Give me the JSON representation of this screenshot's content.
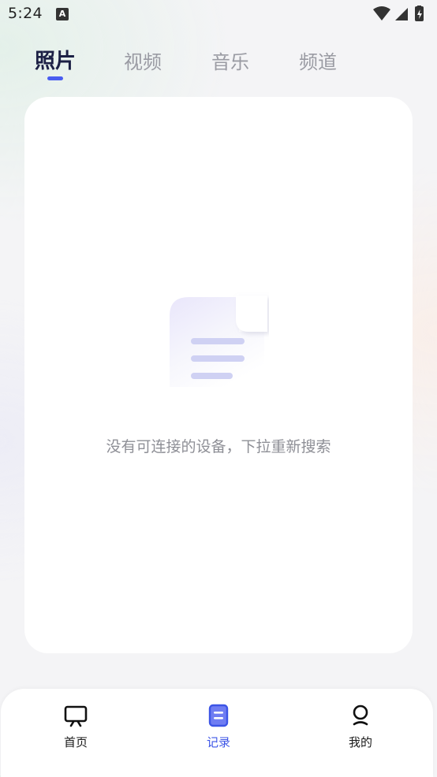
{
  "status_bar": {
    "time": "5:24",
    "notification_glyph": "A",
    "icons": [
      "wifi-icon",
      "signal-icon",
      "battery-charging-icon"
    ]
  },
  "tabs": [
    {
      "label": "照片",
      "active": true
    },
    {
      "label": "视频",
      "active": false
    },
    {
      "label": "音乐",
      "active": false
    },
    {
      "label": "频道",
      "active": false
    }
  ],
  "main": {
    "empty_icon": "document-icon",
    "empty_message": "没有可连接的设备，下拉重新搜索"
  },
  "bottom_nav": {
    "items": [
      {
        "label": "首页",
        "icon": "tv-icon",
        "active": false
      },
      {
        "label": "记录",
        "icon": "record-icon",
        "active": true
      },
      {
        "label": "我的",
        "icon": "profile-icon",
        "active": false
      }
    ]
  },
  "colors": {
    "accent": "#4a5df0",
    "active_tab_text": "#1c2045",
    "inactive_tab_text": "#9a9ba3",
    "empty_text": "#8e8f96"
  }
}
